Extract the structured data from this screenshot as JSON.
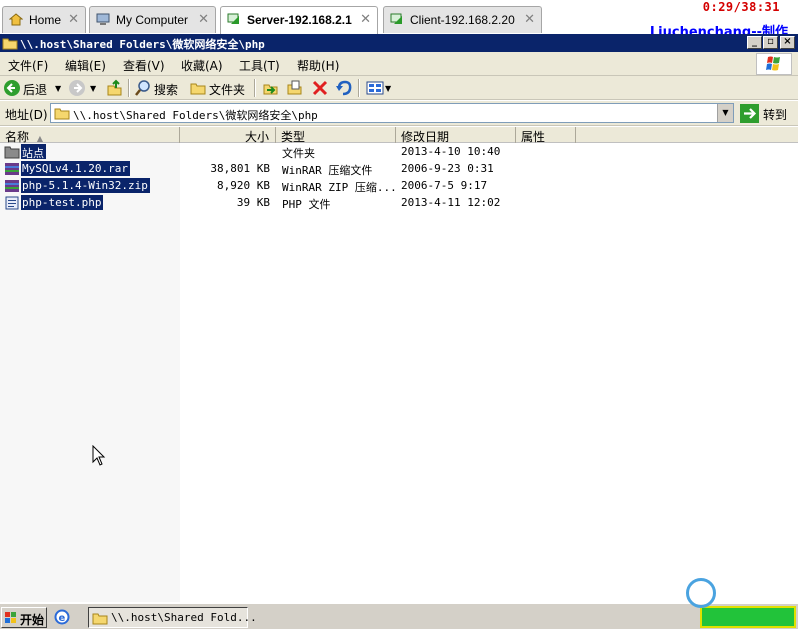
{
  "tabs": [
    {
      "label": "Home",
      "icon": "home-icon"
    },
    {
      "label": "My Computer",
      "icon": "computer-icon"
    },
    {
      "label": "Server-192.168.2.1",
      "icon": "vm-icon",
      "active": true
    },
    {
      "label": "Client-192.168.2.20",
      "icon": "vm-icon"
    }
  ],
  "timer": "0:29/38:31",
  "author_text": "Liuchenchang--制作",
  "window": {
    "title": "\\\\.host\\Shared Folders\\微软网络安全\\php"
  },
  "menu": [
    "文件(F)",
    "编辑(E)",
    "查看(V)",
    "收藏(A)",
    "工具(T)",
    "帮助(H)"
  ],
  "toolbar": {
    "back": "后退",
    "search": "搜索",
    "folders": "文件夹"
  },
  "address": {
    "label": "地址(D)",
    "value": "\\\\.host\\Shared Folders\\微软网络安全\\php",
    "go": "转到"
  },
  "columns": [
    "名称",
    "大小",
    "类型",
    "修改日期",
    "属性"
  ],
  "files": [
    {
      "name": "站点",
      "size": "",
      "type": "文件夹",
      "date": "2013-4-10 10:40",
      "icon": "folder-icon"
    },
    {
      "name": "MySQLv4.1.20.rar",
      "size": "38,801 KB",
      "type": "WinRAR 压缩文件",
      "date": "2006-9-23 0:31",
      "icon": "rar-icon"
    },
    {
      "name": "php-5.1.4-Win32.zip",
      "size": "8,920 KB",
      "type": "WinRAR ZIP 压缩...",
      "date": "2006-7-5 9:17",
      "icon": "zip-icon"
    },
    {
      "name": "php-test.php",
      "size": "39 KB",
      "type": "PHP 文件",
      "date": "2013-4-11 12:02",
      "icon": "php-file-icon"
    }
  ],
  "taskbar": {
    "start": "开始",
    "task_item": "\\\\.host\\Shared Fold..."
  },
  "colors": {
    "titlebar": "#0a246a",
    "selection": "#0a246a",
    "timer": "#d40000",
    "author": "#0000ff",
    "chrome": "#ece9d8"
  }
}
